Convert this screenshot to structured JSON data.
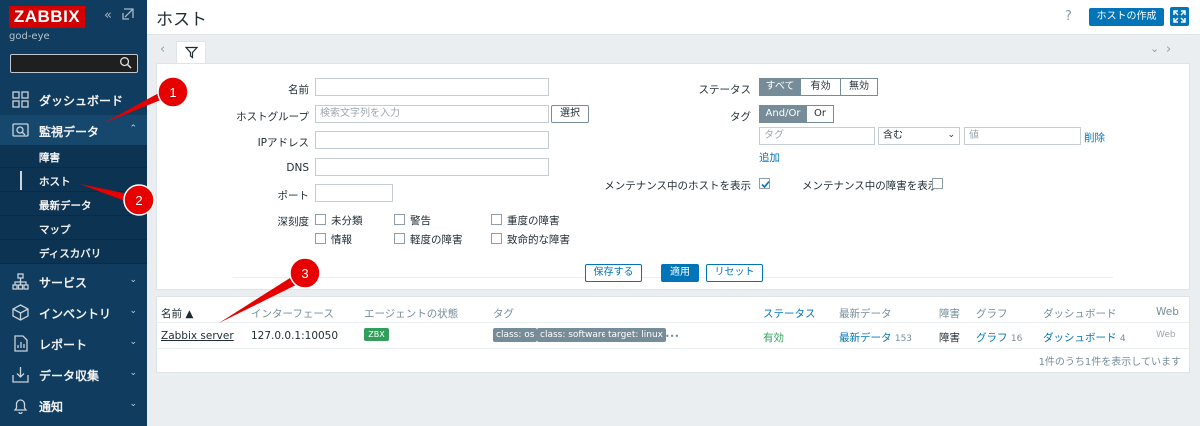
{
  "sidebar": {
    "logo": "ZABBIX",
    "server_name": "god-eye",
    "nav": {
      "dashboard": "ダッシュボード",
      "monitoring": "監視データ",
      "services": "サービス",
      "inventory": "インベントリ",
      "reports": "レポート",
      "data_collection": "データ収集",
      "alerts": "通知"
    },
    "submenu": [
      "障害",
      "ホスト",
      "最新データ",
      "マップ",
      "ディスカバリ"
    ]
  },
  "header": {
    "title": "ホスト",
    "help": "?",
    "create_button": "ホストの作成"
  },
  "filter": {
    "labels": {
      "name": "名前",
      "host_group": "ホストグループ",
      "ip": "IPアドレス",
      "dns": "DNS",
      "port": "ポート",
      "severity": "深刻度",
      "status": "ステータス",
      "tags": "タグ",
      "maint_hosts": "メンテナンス中のホストを表示",
      "maint_problems": "メンテナンス中の障害を表示"
    },
    "host_group_placeholder": "検索文字列を入力",
    "select_button": "選択",
    "severity": [
      "未分類",
      "警告",
      "重度の障害",
      "情報",
      "軽度の障害",
      "致命的な障害"
    ],
    "status_options": [
      "すべて",
      "有効",
      "無効"
    ],
    "tag_ops": [
      "And/Or",
      "Or"
    ],
    "tag_placeholder": "タグ",
    "tag_operator": "含む",
    "value_placeholder": "値",
    "remove": "削除",
    "add": "追加",
    "save_as": "保存する",
    "apply": "適用",
    "reset": "リセット"
  },
  "table": {
    "headers": [
      "名前 ▲",
      "インターフェース",
      "エージェントの状態",
      "タグ",
      "ステータス",
      "最新データ",
      "障害",
      "グラフ",
      "ダッシュボード",
      "Web"
    ],
    "row": {
      "name": "Zabbix server",
      "interface": "127.0.0.1:10050",
      "agent": "ZBX",
      "tags": [
        "class: os",
        "class: software",
        "target: linux"
      ],
      "more": "•••",
      "status": "有効",
      "latest": "最新データ",
      "latest_count": "153",
      "problems": "障害",
      "graphs": "グラフ",
      "graphs_count": "16",
      "dashboards": "ダッシュボード",
      "dashboards_count": "4",
      "web": "Web"
    },
    "footer": "1件のうち1件を表示しています"
  },
  "annotations": [
    "1",
    "2",
    "3"
  ],
  "colors": {
    "sidebar": "#0f3c5f",
    "accent": "#0275b8",
    "logo": "#d40000",
    "annotation": "#e60000",
    "ok": "#2f9f5b"
  }
}
